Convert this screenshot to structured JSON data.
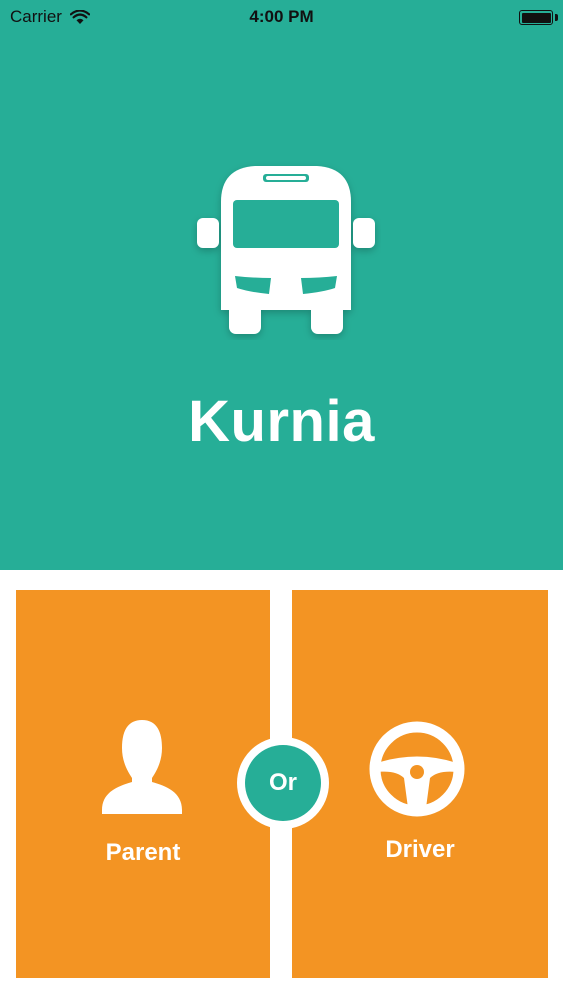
{
  "status_bar": {
    "carrier": "Carrier",
    "time": "4:00 PM",
    "icons": {
      "wifi": "wifi-icon",
      "battery": "battery-icon"
    }
  },
  "hero": {
    "icon": "bus-icon",
    "app_name": "Kurnia",
    "background_color": "#26ae97"
  },
  "roles": {
    "parent": {
      "icon": "person-icon",
      "label": "Parent"
    },
    "separator": "Or",
    "driver": {
      "icon": "steering-wheel-icon",
      "label": "Driver"
    },
    "panel_color": "#f39423"
  }
}
